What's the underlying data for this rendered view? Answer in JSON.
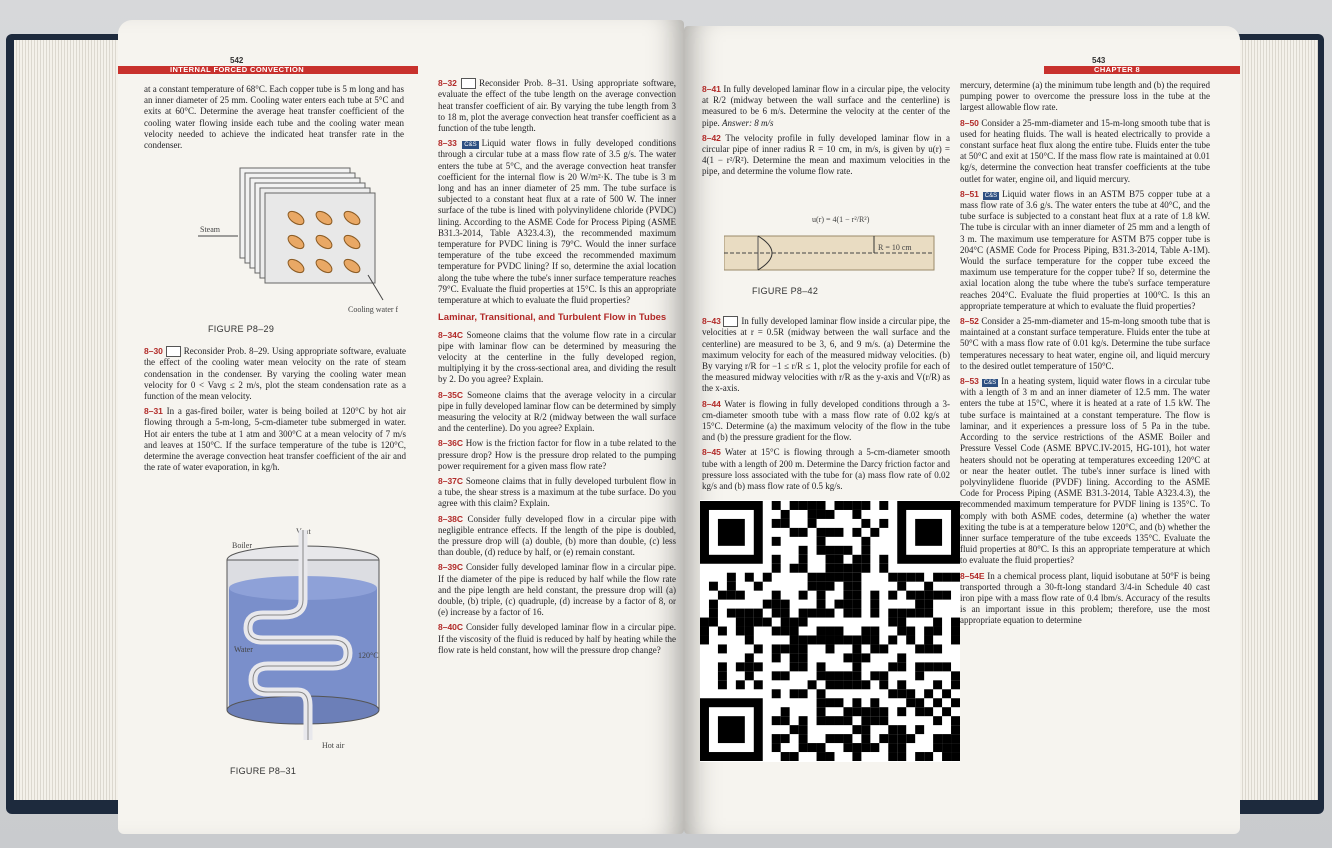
{
  "left_page": {
    "page_number": "542",
    "running_head": "INTERNAL FORCED CONVECTION",
    "col1": {
      "intro": "at a constant temperature of 68°C. Each copper tube is 5 m long and has an inner diameter of 25 mm. Cooling water enters each tube at 5°C and exits at 60°C. Determine the average heat transfer coefficient of the cooling water flowing inside each tube and the cooling water mean velocity needed to achieve the indicated heat transfer rate in the condenser.",
      "fig29_steam": "Steam",
      "fig29_cooling": "Cooling water flow",
      "fig29_caption": "FIGURE P8–29",
      "p830_num": "8–30",
      "p830": "Reconsider Prob. 8–29. Using appropriate software, evaluate the effect of the cooling water mean velocity on the rate of steam condensation in the condenser. By varying the cooling water mean velocity for 0 < Vavg ≤ 2 m/s, plot the steam condensation rate as a function of the mean velocity.",
      "p831_num": "8–31",
      "p831": "In a gas-fired boiler, water is being boiled at 120°C by hot air flowing through a 5-m-long, 5-cm-diameter tube submerged in water. Hot air enters the tube at 1 atm and 300°C at a mean velocity of 7 m/s and leaves at 150°C. If the surface temperature of the tube is 120°C, determine the average convection heat transfer coefficient of the air and the rate of water evaporation, in kg/h.",
      "fig31_vent": "Vent",
      "fig31_boiler": "Boiler",
      "fig31_water": "Water",
      "fig31_temp": "120°C",
      "fig31_hotair": "Hot air",
      "fig31_caption": "FIGURE P8–31"
    },
    "col2": {
      "p832_num": "8–32",
      "p832": "Reconsider Prob. 8–31. Using appropriate software, evaluate the effect of the tube length on the average convection heat transfer coefficient of air. By varying the tube length from 3 to 18 m, plot the average convection heat transfer coefficient as a function of the tube length.",
      "p833_num": "8–33",
      "p833": "Liquid water flows in fully developed conditions through a circular tube at a mass flow rate of 3.5 g/s. The water enters the tube at 5°C, and the average convection heat transfer coefficient for the internal flow is 20 W/m²·K. The tube is 3 m long and has an inner diameter of 25 mm. The tube surface is subjected to a constant heat flux at a rate of 500 W. The inner surface of the tube is lined with polyvinylidene chloride (PVDC) lining. According to the ASME Code for Process Piping (ASME B31.3-2014, Table A323.4.3), the recommended maximum temperature for PVDC lining is 79°C. Would the inner surface temperature of the tube exceed the recommended maximum temperature for PVDC lining? If so, determine the axial location along the tube where the tube's inner surface temperature reaches 79°C. Evaluate the fluid properties at 15°C. Is this an appropriate temperature at which to evaluate the fluid properties?",
      "section_title": "Laminar, Transitional, and Turbulent Flow in Tubes",
      "p834_num": "8–34C",
      "p834": "Someone claims that the volume flow rate in a circular pipe with laminar flow can be determined by measuring the velocity at the centerline in the fully developed region, multiplying it by the cross-sectional area, and dividing the result by 2. Do you agree? Explain.",
      "p835_num": "8–35C",
      "p835": "Someone claims that the average velocity in a circular pipe in fully developed laminar flow can be determined by simply measuring the velocity at R/2 (midway between the wall surface and the centerline). Do you agree? Explain.",
      "p836_num": "8–36C",
      "p836": "How is the friction factor for flow in a tube related to the pressure drop? How is the pressure drop related to the pumping power requirement for a given mass flow rate?",
      "p837_num": "8–37C",
      "p837": "Someone claims that in fully developed turbulent flow in a tube, the shear stress is a maximum at the tube surface. Do you agree with this claim? Explain.",
      "p838_num": "8–38C",
      "p838": "Consider fully developed flow in a circular pipe with negligible entrance effects. If the length of the pipe is doubled, the pressure drop will (a) double, (b) more than double, (c) less than double, (d) reduce by half, or (e) remain constant.",
      "p839_num": "8–39C",
      "p839": "Consider fully developed laminar flow in a circular pipe. If the diameter of the pipe is reduced by half while the flow rate and the pipe length are held constant, the pressure drop will (a) double, (b) triple, (c) quadruple, (d) increase by a factor of 8, or (e) increase by a factor of 16.",
      "p840_num": "8–40C",
      "p840": "Consider fully developed laminar flow in a circular pipe. If the viscosity of the fluid is reduced by half by heating while the flow rate is held constant, how will the pressure drop change?"
    }
  },
  "right_page": {
    "page_number": "543",
    "running_head": "CHAPTER 8",
    "col1": {
      "p841_num": "8–41",
      "p841": "In fully developed laminar flow in a circular pipe, the velocity at R/2 (midway between the wall surface and the centerline) is measured to be 6 m/s. Determine the velocity at the center of the pipe.",
      "p841_answer": "Answer: 8 m/s",
      "p842_num": "8–42",
      "p842": "The velocity profile in fully developed laminar flow in a circular pipe of inner radius R = 10 cm, in m/s, is given by u(r) = 4(1 − r²/R²). Determine the mean and maximum velocities in the pipe, and determine the volume flow rate.",
      "fig42_eq": "u(r) = 4(1 − r²/R²)",
      "fig42_r": "R = 10 cm",
      "fig42_caption": "FIGURE P8–42",
      "p843_num": "8–43",
      "p843": "In fully developed laminar flow inside a circular pipe, the velocities at r = 0.5R (midway between the wall surface and the centerline) are measured to be 3, 6, and 9 m/s. (a) Determine the maximum velocity for each of the measured midway velocities. (b) By varying r/R for −1 ≤ r/R ≤ 1, plot the velocity profile for each of the measured midway velocities with r/R as the y-axis and V(r/R) as the x-axis.",
      "p844_num": "8–44",
      "p844": "Water is flowing in fully developed conditions through a 3-cm-diameter smooth tube with a mass flow rate of 0.02 kg/s at 15°C. Determine (a) the maximum velocity of the flow in the tube and (b) the pressure gradient for the flow.",
      "p845_num": "8–45",
      "p845": "Water at 15°C is flowing through a 5-cm-diameter smooth tube with a length of 200 m. Determine the Darcy friction factor and pressure loss associated with the tube for (a) mass flow rate of 0.02 kg/s and (b) mass flow rate of 0.5 kg/s."
    },
    "col2": {
      "p_cont": "mercury, determine (a) the minimum tube length and (b) the required pumping power to overcome the pressure loss in the tube at the largest allowable flow rate.",
      "p850_num": "8–50",
      "p850": "Consider a 25-mm-diameter and 15-m-long smooth tube that is used for heating fluids. The wall is heated electrically to provide a constant surface heat flux along the entire tube. Fluids enter the tube at 50°C and exit at 150°C. If the mass flow rate is maintained at 0.01 kg/s, determine the convection heat transfer coefficients at the tube outlet for water, engine oil, and liquid mercury.",
      "p851_num": "8–51",
      "p851": "Liquid water flows in an ASTM B75 copper tube at a mass flow rate of 3.6 g/s. The water enters the tube at 40°C, and the tube surface is subjected to a constant heat flux at a rate of 1.8 kW. The tube is circular with an inner diameter of 25 mm and a length of 3 m. The maximum use temperature for ASTM B75 copper tube is 204°C (ASME Code for Process Piping, B31.3-2014, Table A-1M). Would the surface temperature for the copper tube exceed the maximum use temperature for the copper tube? If so, determine the axial location along the tube where the tube's surface temperature reaches 204°C. Evaluate the fluid properties at 100°C. Is this an appropriate temperature at which to evaluate the fluid properties?",
      "p852_num": "8–52",
      "p852": "Consider a 25-mm-diameter and 15-m-long smooth tube that is maintained at a constant surface temperature. Fluids enter the tube at 50°C with a mass flow rate of 0.01 kg/s. Determine the tube surface temperatures necessary to heat water, engine oil, and liquid mercury to the desired outlet temperature of 150°C.",
      "p853_num": "8–53",
      "p853": "In a heating system, liquid water flows in a circular tube with a length of 3 m and an inner diameter of 12.5 mm. The water enters the tube at 15°C, where it is heated at a rate of 1.5 kW. The tube surface is maintained at a constant temperature. The flow is laminar, and it experiences a pressure loss of 5 Pa in the tube. According to the service restrictions of the ASME Boiler and Pressure Vessel Code (ASME BPVC.IV-2015, HG-101), hot water heaters should not be operating at temperatures exceeding 120°C at or near the heater outlet. The tube's inner surface is lined with polyvinylidene fluoride (PVDF) lining. According to the ASME Code for Process Piping (ASME B31.3-2014, Table A323.4.3), the recommended maximum temperature for PVDF lining is 135°C. To comply with both ASME codes, determine (a) whether the water exiting the tube is at a temperature below 120°C, and (b) whether the inner surface temperature of the tube exceeds 135°C. Evaluate the fluid properties at 80°C. Is this an appropriate temperature at which to evaluate the fluid properties?",
      "p854_num": "8–54E",
      "p854": "In a chemical process plant, liquid isobutane at 50°F is being transported through a 30-ft-long standard 3/4-in Schedule 40 cast iron pipe with a mass flow rate of 0.4 lbm/s. Accuracy of the results is an important issue in this problem; therefore, use the most appropriate equation to determine"
    },
    "ebadge": "C&S"
  },
  "colors": {
    "accent_red": "#c8312d",
    "cover": "#1d2a3d",
    "water": "#6f86c9"
  }
}
